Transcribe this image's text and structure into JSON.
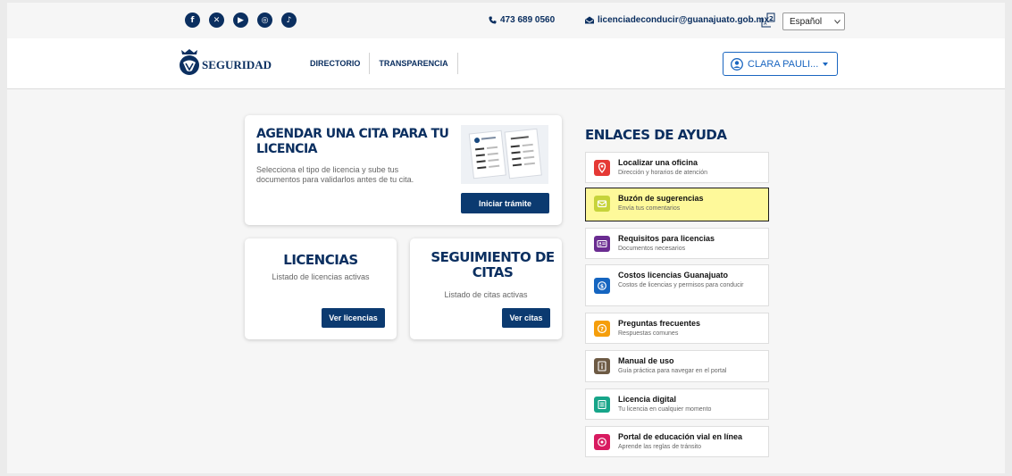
{
  "topbar": {
    "social": [
      {
        "icon": "facebook-icon",
        "glyph": "f"
      },
      {
        "icon": "x-icon",
        "glyph": "✕"
      },
      {
        "icon": "youtube-icon",
        "glyph": "▶"
      },
      {
        "icon": "instagram-icon",
        "glyph": "◎"
      },
      {
        "icon": "tiktok-icon",
        "glyph": "♪"
      }
    ],
    "phone": "473 689 0560",
    "email": "licenciadeconducir@guanajuato.gob.mx",
    "language": "Español"
  },
  "navbar": {
    "logo_text": "SEGURIDAD",
    "links": [
      "DIRECTORIO",
      "TRANSPARENCIA"
    ],
    "user_name": "CLARA PAULI..."
  },
  "cards": {
    "agendar": {
      "title": "AGENDAR UNA CITA PARA TU LICENCIA",
      "description": "Selecciona el tipo de licencia y sube tus documentos para validarlos antes de tu cita.",
      "button": "Iniciar trámite"
    },
    "licencias": {
      "title": "LICENCIAS",
      "description": "Listado de licencias activas",
      "button": "Ver licencias"
    },
    "seguimiento": {
      "title": "SEGUIMIENTO DE CITAS",
      "description": "Listado de citas activas",
      "button": "Ver citas"
    }
  },
  "help": {
    "title": "ENLACES DE AYUDA",
    "items": [
      {
        "name": "Localizar una oficina",
        "sub": "Dirección y horarios de atención",
        "icon": "map-pin-icon",
        "color": "#e53935",
        "glyph": "⚲"
      },
      {
        "name": "Buzón de sugerencias",
        "sub": "Envía tus comentarios",
        "icon": "mailbox-icon",
        "color": "#c6d33a",
        "glyph": "✉"
      },
      {
        "name": "Requisitos para licencias",
        "sub": "Documentos necesarios",
        "icon": "id-card-icon",
        "color": "#6a2c91",
        "glyph": "▤"
      },
      {
        "name": "Costos licencias Guanajuato",
        "sub": "Costos de licencias y permisos para conducir",
        "icon": "coin-icon",
        "color": "#1565c0",
        "glyph": "$"
      },
      {
        "name": "Preguntas frecuentes",
        "sub": "Respuestas comunes",
        "icon": "question-icon",
        "color": "#f59e0b",
        "glyph": "?"
      },
      {
        "name": "Manual de uso",
        "sub": "Guía práctica para navegar en el portal",
        "icon": "manual-icon",
        "color": "#6d5a44",
        "glyph": "i"
      },
      {
        "name": "Licencia digital",
        "sub": "Tu licencia en cualquier momento",
        "icon": "digital-license-icon",
        "color": "#17a589",
        "glyph": "≡"
      },
      {
        "name": "Portal de educación vial en línea",
        "sub": "Aprende las reglas de tránsito",
        "icon": "education-icon",
        "color": "#d81b60",
        "glyph": "✦"
      }
    ]
  }
}
